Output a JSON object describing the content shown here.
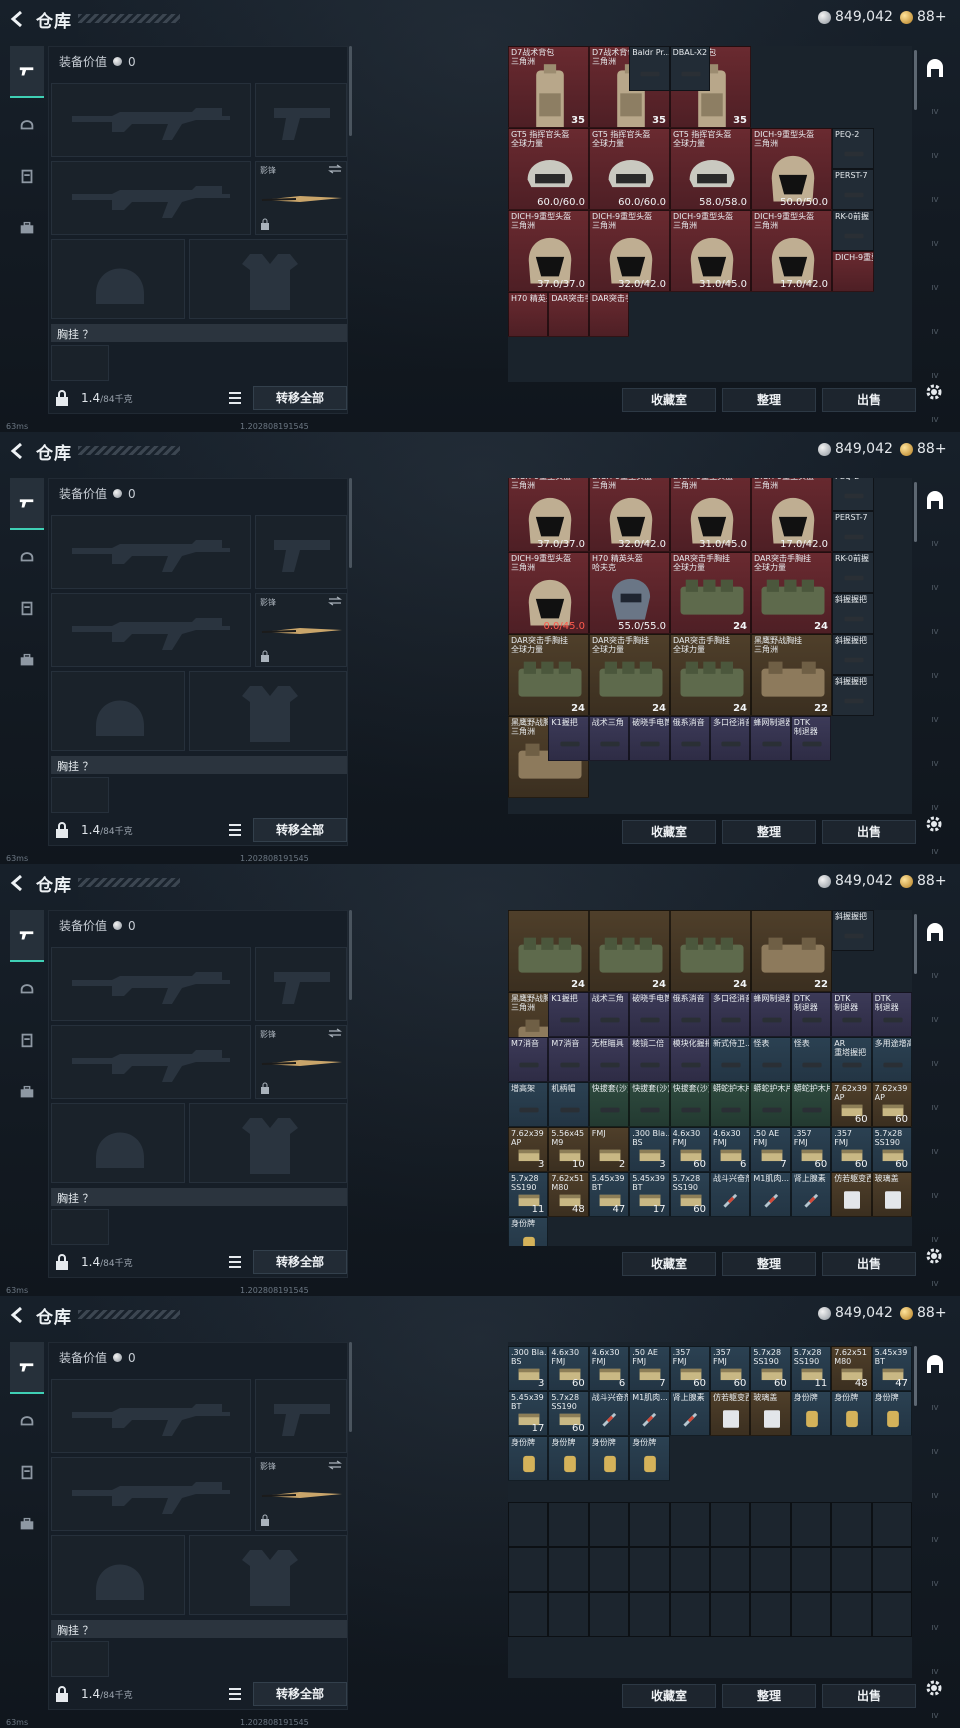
{
  "header": {
    "title": "仓库",
    "silver": "849,042",
    "gold": "88+"
  },
  "loadout": {
    "equip_value_label": "装备价值",
    "equip_value": "0",
    "melee_label": "影锋",
    "chest_label": "胸挂 ？",
    "weight": "1.4",
    "weight_max": "/84千克",
    "transfer_all": "转移全部"
  },
  "status": {
    "ping": "63ms",
    "build": "1.202808191545"
  },
  "buttons": {
    "stash": "收藏室",
    "sort": "整理",
    "sell": "出售"
  },
  "right_tabs": [
    "IV",
    "IV",
    "IV",
    "IV",
    "IV",
    "IV",
    "IV",
    "IV"
  ],
  "strips": [
    {
      "cells": [
        {
          "name": "D7战术背包\n三角洲",
          "val": "35",
          "bag": true,
          "color": "red",
          "shape": "bag"
        },
        {
          "name": "D7战术背包\n三角洲",
          "val": "35",
          "bag": true,
          "color": "red",
          "shape": "bag"
        },
        {
          "name": "D7战术背包\n三角洲",
          "val": "35",
          "bag": true,
          "color": "red",
          "shape": "bag"
        },
        {
          "name": "Baldr Pr...",
          "val": "",
          "color": "grey",
          "shape": "small"
        },
        {
          "name": "DBAL-X2",
          "val": "",
          "color": "grey",
          "shape": "small"
        },
        {
          "name": "GT5 指挥官头盔\n全球力量",
          "val": "60.0/60.0",
          "color": "red",
          "shape": "helmet"
        },
        {
          "name": "GT5 指挥官头盔\n全球力量",
          "val": "60.0/60.0",
          "color": "red",
          "shape": "helmet"
        },
        {
          "name": "GT5 指挥官头盔\n全球力量",
          "val": "58.0/58.0",
          "color": "red",
          "shape": "helmet"
        },
        {
          "name": "DICH-9重型头盔\n三角洲",
          "val": "50.0/50.0",
          "color": "red",
          "shape": "helmet2"
        },
        {
          "name": "PEQ-2",
          "val": "",
          "color": "grey",
          "shape": "small"
        },
        {
          "name": "PERST-7",
          "val": "",
          "color": "grey",
          "shape": "small"
        },
        {
          "name": "DICH-9重型头盔\n三角洲",
          "val": "37.0/37.0",
          "color": "red",
          "shape": "helmet2"
        },
        {
          "name": "DICH-9重型头盔\n三角洲",
          "val": "32.0/42.0",
          "color": "red",
          "shape": "helmet2"
        },
        {
          "name": "DICH-9重型头盔\n三角洲",
          "val": "31.0/45.0",
          "color": "red",
          "shape": "helmet2"
        },
        {
          "name": "DICH-9重型头盔\n三角洲",
          "val": "17.0/42.0",
          "color": "red",
          "shape": "helmet2"
        },
        {
          "name": "RK-0前握",
          "val": "",
          "color": "grey",
          "shape": "small"
        },
        {
          "name": "DICH-9重型头盔",
          "val": "",
          "color": "red",
          "shape": "none"
        },
        {
          "name": "H70 精英头盔",
          "val": "",
          "color": "red",
          "shape": "none"
        },
        {
          "name": "DAR突击手胸挂",
          "val": "",
          "color": "red",
          "shape": "none"
        },
        {
          "name": "DAR突击手胸挂",
          "val": "",
          "color": "red",
          "shape": "none"
        }
      ]
    },
    {
      "cells": [
        {
          "name": "DICH-9重型头盔\n三角洲",
          "val": "37.0/37.0",
          "color": "red",
          "shape": "helmet2"
        },
        {
          "name": "DICH-9重型头盔\n三角洲",
          "val": "32.0/42.0",
          "color": "red",
          "shape": "helmet2"
        },
        {
          "name": "DICH-9重型头盔\n三角洲",
          "val": "31.0/45.0",
          "color": "red",
          "shape": "helmet2"
        },
        {
          "name": "DICH-9重型头盔\n三角洲",
          "val": "17.0/42.0",
          "color": "red",
          "shape": "helmet2"
        },
        {
          "name": "PEQ-2",
          "val": "",
          "color": "grey",
          "shape": "small"
        },
        {
          "name": "PERST-7",
          "val": "",
          "color": "grey",
          "shape": "small"
        },
        {
          "name": "DICH-9重型头盔\n三角洲",
          "val": "0.0/45.0",
          "red": true,
          "color": "red",
          "shape": "helmet2"
        },
        {
          "name": "H70 精英头盔\n哈夫克",
          "val": "55.0/55.0",
          "color": "red",
          "shape": "helmet3"
        },
        {
          "name": "DAR突击手胸挂\n全球力量",
          "val": "24",
          "bag": true,
          "color": "red",
          "shape": "rig"
        },
        {
          "name": "DAR突击手胸挂\n全球力量",
          "val": "24",
          "bag": true,
          "color": "red",
          "shape": "rig"
        },
        {
          "name": "RK-0前握",
          "val": "",
          "color": "grey",
          "shape": "small"
        },
        {
          "name": "斜握握把",
          "val": "",
          "color": "grey",
          "shape": "small"
        },
        {
          "name": "DAR突击手胸挂\n全球力量",
          "val": "24",
          "bag": true,
          "color": "gold",
          "shape": "rig"
        },
        {
          "name": "DAR突击手胸挂\n全球力量",
          "val": "24",
          "bag": true,
          "color": "gold",
          "shape": "rig"
        },
        {
          "name": "DAR突击手胸挂\n全球力量",
          "val": "24",
          "bag": true,
          "color": "gold",
          "shape": "rig"
        },
        {
          "name": "黑鹰野战胸挂\n三角洲",
          "val": "22",
          "bag": true,
          "color": "gold",
          "shape": "rig2"
        },
        {
          "name": "斜握握把",
          "val": "",
          "color": "grey",
          "shape": "small"
        },
        {
          "name": "斜握握把",
          "val": "",
          "color": "grey",
          "shape": "small"
        },
        {
          "name": "黑鹰野战胸挂\n三角洲",
          "val": "",
          "color": "gold",
          "shape": "rig2"
        },
        {
          "name": "K1握把",
          "val": "",
          "color": "purple",
          "shape": "small"
        },
        {
          "name": "战术三角",
          "val": "",
          "color": "purple",
          "shape": "small"
        },
        {
          "name": "破晓手电筒",
          "val": "",
          "color": "purple",
          "shape": "small"
        },
        {
          "name": "俄系消音",
          "val": "",
          "color": "purple",
          "shape": "small"
        },
        {
          "name": "多口径消音",
          "val": "",
          "color": "purple",
          "shape": "small"
        },
        {
          "name": "蜂网制退器",
          "val": "",
          "color": "purple",
          "shape": "small"
        },
        {
          "name": "DTK\n制退器",
          "val": "",
          "color": "purple",
          "shape": "small"
        }
      ]
    },
    {
      "cells": [
        {
          "name": "",
          "val": "24",
          "bag": true,
          "color": "gold",
          "shape": "rig"
        },
        {
          "name": "",
          "val": "24",
          "bag": true,
          "color": "gold",
          "shape": "rig"
        },
        {
          "name": "",
          "val": "24",
          "bag": true,
          "color": "gold",
          "shape": "rig"
        },
        {
          "name": "",
          "val": "22",
          "bag": true,
          "color": "gold",
          "shape": "rig2"
        },
        {
          "name": "斜握握把",
          "val": "",
          "color": "grey",
          "shape": "small"
        },
        {
          "name": "黑鹰野战胸挂\n三角洲",
          "val": "22",
          "bag": true,
          "color": "gold",
          "shape": "rig2"
        },
        {
          "name": "K1握把",
          "val": "",
          "color": "purple",
          "shape": "small"
        },
        {
          "name": "战术三角",
          "val": "",
          "color": "purple",
          "shape": "small"
        },
        {
          "name": "破晓手电筒",
          "val": "",
          "color": "purple",
          "shape": "small"
        },
        {
          "name": "俄系消音",
          "val": "",
          "color": "purple",
          "shape": "small"
        },
        {
          "name": "多口径消音",
          "val": "",
          "color": "purple",
          "shape": "small"
        },
        {
          "name": "蜂网制退器",
          "val": "",
          "color": "purple",
          "shape": "small"
        },
        {
          "name": "DTK\n制退器",
          "val": "",
          "color": "purple",
          "shape": "small"
        },
        {
          "name": "DTK\n制退器",
          "val": "",
          "color": "purple",
          "shape": "small"
        },
        {
          "name": "DTK\n制退器",
          "val": "",
          "color": "purple",
          "shape": "small"
        },
        {
          "name": "M7消音",
          "val": "",
          "color": "purple",
          "shape": "small"
        },
        {
          "name": "M7消音",
          "val": "",
          "color": "purple",
          "shape": "small"
        },
        {
          "name": "无框瞄具",
          "val": "",
          "color": "purple",
          "shape": "small"
        },
        {
          "name": "棱镜二倍",
          "val": "",
          "color": "purple",
          "shape": "small"
        },
        {
          "name": "模块化握把",
          "val": "",
          "color": "purple",
          "shape": "small"
        },
        {
          "name": "新式侍卫...",
          "val": "",
          "color": "blue",
          "shape": "small"
        },
        {
          "name": "怪表",
          "val": "",
          "color": "blue",
          "shape": "small"
        },
        {
          "name": "怪表",
          "val": "",
          "color": "blue",
          "shape": "small"
        },
        {
          "name": "AR\n重塔握把",
          "val": "",
          "color": "blue",
          "shape": "small"
        },
        {
          "name": "多用途增高",
          "val": "",
          "color": "blue",
          "shape": "small"
        },
        {
          "name": "增高架",
          "val": "",
          "color": "blue",
          "shape": "small"
        },
        {
          "name": "机柄帽",
          "val": "",
          "color": "blue",
          "shape": "small"
        },
        {
          "name": "快拔套(沙)",
          "val": "",
          "color": "green",
          "shape": "small"
        },
        {
          "name": "快拔套(沙)",
          "val": "",
          "color": "green",
          "shape": "small"
        },
        {
          "name": "快拔套(沙)",
          "val": "",
          "color": "green",
          "shape": "small"
        },
        {
          "name": "蟒蛇护木片",
          "val": "",
          "color": "green",
          "shape": "small"
        },
        {
          "name": "蟒蛇护木片",
          "val": "",
          "color": "green",
          "shape": "small"
        },
        {
          "name": "蟒蛇护木片",
          "val": "",
          "color": "green",
          "shape": "small"
        },
        {
          "name": "7.62x39\nAP",
          "val": "60",
          "color": "gold",
          "shape": "ammo"
        },
        {
          "name": "7.62x39\nAP",
          "val": "60",
          "color": "gold",
          "shape": "ammo"
        },
        {
          "name": "7.62x39\nAP",
          "val": "3",
          "color": "gold",
          "shape": "ammo"
        },
        {
          "name": "5.56x45\nM9",
          "val": "10",
          "color": "gold",
          "shape": "ammo"
        },
        {
          "name": "FMJ",
          "val": "2",
          "color": "gold",
          "shape": "ammo"
        },
        {
          "name": ".300 Bla...\nBS",
          "val": "3",
          "color": "blue",
          "shape": "ammo"
        },
        {
          "name": "4.6x30\nFMJ",
          "val": "60",
          "color": "blue",
          "shape": "ammo"
        },
        {
          "name": "4.6x30\nFMJ",
          "val": "6",
          "color": "blue",
          "shape": "ammo"
        },
        {
          "name": ".50 AE\nFMJ",
          "val": "7",
          "color": "blue",
          "shape": "ammo"
        },
        {
          "name": ".357\nFMJ",
          "val": "60",
          "color": "blue",
          "shape": "ammo"
        },
        {
          "name": ".357\nFMJ",
          "val": "60",
          "color": "blue",
          "shape": "ammo"
        },
        {
          "name": "5.7x28\nSS190",
          "val": "60",
          "color": "blue",
          "shape": "ammo"
        },
        {
          "name": "5.7x28\nSS190",
          "val": "11",
          "color": "blue",
          "shape": "ammo"
        },
        {
          "name": "7.62x51\nM80",
          "val": "48",
          "color": "gold",
          "shape": "ammo"
        },
        {
          "name": "5.45x39\nBT",
          "val": "47",
          "color": "blue",
          "shape": "ammo"
        },
        {
          "name": "5.45x39\nBT",
          "val": "17",
          "color": "blue",
          "shape": "ammo"
        },
        {
          "name": "5.7x28\nSS190",
          "val": "60",
          "color": "blue",
          "shape": "ammo"
        },
        {
          "name": "战斗兴奋剂",
          "val": "",
          "color": "blue",
          "shape": "syringe"
        },
        {
          "name": "M1肌肉...",
          "val": "",
          "color": "blue",
          "shape": "syringe"
        },
        {
          "name": "肾上腺素",
          "val": "",
          "color": "blue",
          "shape": "syringe"
        },
        {
          "name": "仿若躯变西",
          "val": "",
          "color": "gold",
          "shape": "card"
        },
        {
          "name": "玻璃盖",
          "val": "",
          "color": "gold",
          "shape": "card"
        },
        {
          "name": "身份牌",
          "val": "",
          "color": "blue",
          "shape": "tag"
        }
      ]
    },
    {
      "cells": [
        {
          "name": ".300 Bla...\nBS",
          "val": "3",
          "color": "blue",
          "shape": "ammo"
        },
        {
          "name": "4.6x30\nFMJ",
          "val": "60",
          "color": "blue",
          "shape": "ammo"
        },
        {
          "name": "4.6x30\nFMJ",
          "val": "6",
          "color": "blue",
          "shape": "ammo"
        },
        {
          "name": ".50 AE\nFMJ",
          "val": "7",
          "color": "blue",
          "shape": "ammo"
        },
        {
          "name": ".357\nFMJ",
          "val": "60",
          "color": "blue",
          "shape": "ammo"
        },
        {
          "name": ".357\nFMJ",
          "val": "60",
          "color": "blue",
          "shape": "ammo"
        },
        {
          "name": "5.7x28\nSS190",
          "val": "60",
          "color": "blue",
          "shape": "ammo"
        },
        {
          "name": "5.7x28\nSS190",
          "val": "11",
          "color": "blue",
          "shape": "ammo"
        },
        {
          "name": "7.62x51\nM80",
          "val": "48",
          "color": "gold",
          "shape": "ammo"
        },
        {
          "name": "5.45x39\nBT",
          "val": "47",
          "color": "blue",
          "shape": "ammo"
        },
        {
          "name": "5.45x39\nBT",
          "val": "17",
          "color": "blue",
          "shape": "ammo"
        },
        {
          "name": "5.7x28\nSS190",
          "val": "60",
          "color": "blue",
          "shape": "ammo"
        },
        {
          "name": "战斗兴奋剂",
          "val": "",
          "color": "blue",
          "shape": "syringe"
        },
        {
          "name": "M1肌肉...",
          "val": "",
          "color": "blue",
          "shape": "syringe"
        },
        {
          "name": "肾上腺素",
          "val": "",
          "color": "blue",
          "shape": "syringe"
        },
        {
          "name": "仿若躯变西",
          "val": "",
          "color": "gold",
          "shape": "card"
        },
        {
          "name": "玻璃盖",
          "val": "",
          "color": "gold",
          "shape": "card"
        },
        {
          "name": "身份牌",
          "val": "",
          "color": "blue",
          "shape": "tag"
        },
        {
          "name": "身份牌",
          "val": "",
          "color": "blue",
          "shape": "tag"
        },
        {
          "name": "身份牌",
          "val": "",
          "color": "blue",
          "shape": "tag"
        },
        {
          "name": "身份牌",
          "val": "",
          "color": "blue",
          "shape": "tag"
        },
        {
          "name": "身份牌",
          "val": "",
          "color": "blue",
          "shape": "tag"
        },
        {
          "name": "身份牌",
          "val": "",
          "color": "blue",
          "shape": "tag"
        },
        {
          "name": "身份牌",
          "val": "",
          "color": "blue",
          "shape": "tag"
        }
      ]
    }
  ]
}
